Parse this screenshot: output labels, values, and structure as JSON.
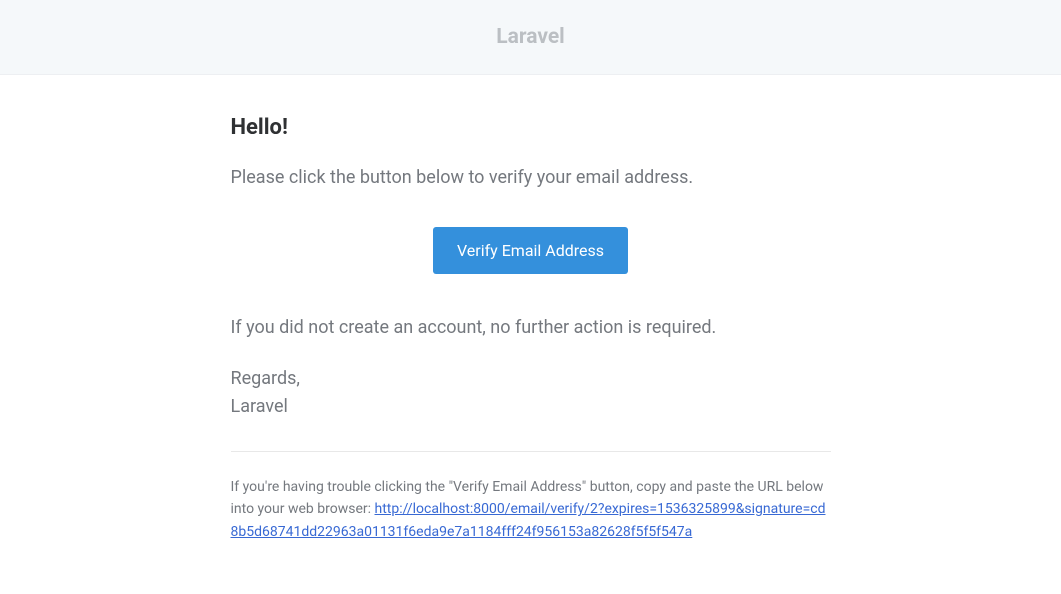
{
  "header": {
    "title": "Laravel"
  },
  "body": {
    "greeting": "Hello!",
    "intro": "Please click the button below to verify your email address.",
    "button_label": "Verify Email Address",
    "outro": "If you did not create an account, no further action is required.",
    "signoff": "Regards,",
    "sender": "Laravel"
  },
  "subcopy": {
    "text_prefix": "If you're having trouble clicking the \"Verify Email Address\" button, copy and paste the URL below into your web browser: ",
    "url": "http://localhost:8000/email/verify/2?expires=1536325899&signature=cd8b5d68741dd22963a01131f6eda9e7a1184fff24f956153a82628f5f5f547a"
  }
}
